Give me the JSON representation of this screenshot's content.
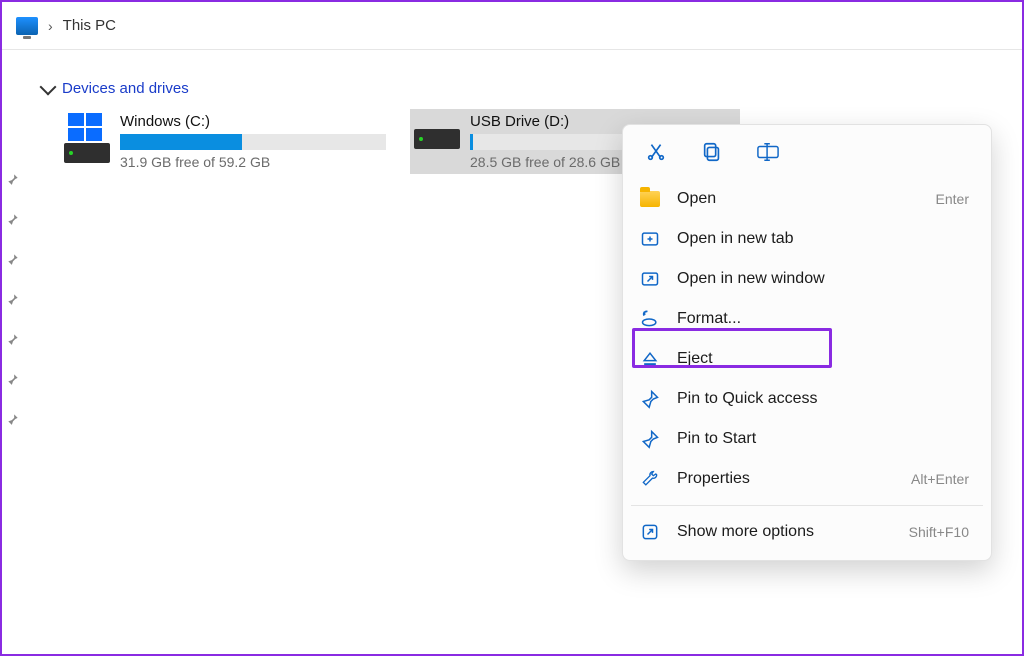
{
  "breadcrumb": {
    "location": "This PC"
  },
  "section": {
    "title": "Devices and drives"
  },
  "drives": [
    {
      "name": "Windows (C:)",
      "subtitle": "31.9 GB free of 59.2 GB",
      "fill_percent": 46,
      "selected": false,
      "has_winlogo": true
    },
    {
      "name": "USB Drive (D:)",
      "subtitle": "28.5 GB free of 28.6 GB",
      "fill_percent": 1,
      "selected": true,
      "has_winlogo": false
    }
  ],
  "context_menu": {
    "items": [
      {
        "icon": "folder",
        "label": "Open",
        "shortcut": "Enter"
      },
      {
        "icon": "newtab",
        "label": "Open in new tab",
        "shortcut": ""
      },
      {
        "icon": "newwindow",
        "label": "Open in new window",
        "shortcut": ""
      },
      {
        "icon": "format",
        "label": "Format...",
        "shortcut": "",
        "highlighted": true
      },
      {
        "icon": "eject",
        "label": "Eject",
        "shortcut": ""
      },
      {
        "icon": "pin",
        "label": "Pin to Quick access",
        "shortcut": ""
      },
      {
        "icon": "pin",
        "label": "Pin to Start",
        "shortcut": ""
      },
      {
        "icon": "wrench",
        "label": "Properties",
        "shortcut": "Alt+Enter"
      }
    ],
    "more": {
      "label": "Show more options",
      "shortcut": "Shift+F10"
    }
  }
}
